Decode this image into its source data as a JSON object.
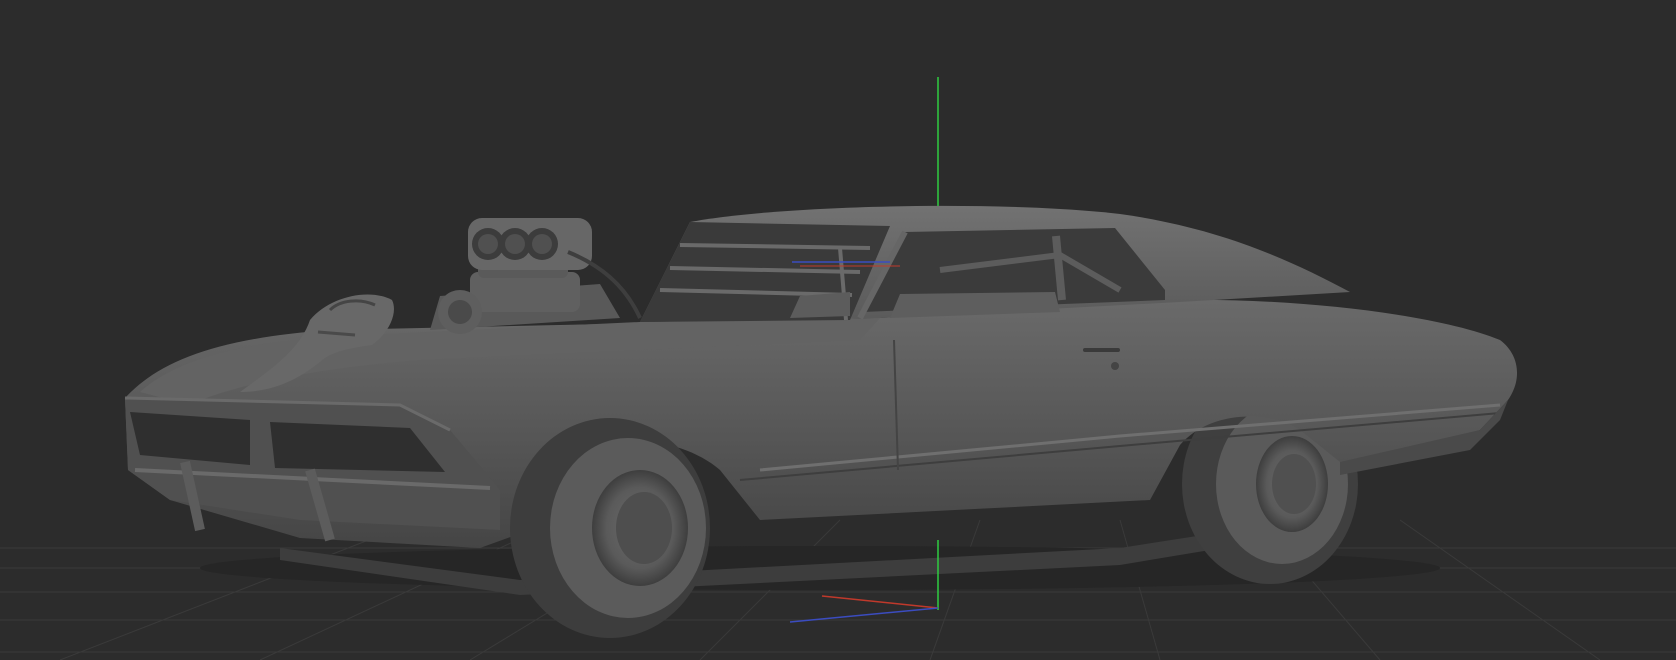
{
  "viewport": {
    "background": "#2c2c2c",
    "grid_visible": true,
    "gizmo_visible": true
  },
  "model": {
    "subject": "muscle-car",
    "material": "clay-gray",
    "base_color": "#555555",
    "shadow_color": "#3a3a3a",
    "highlight_color": "#6e6e6e"
  },
  "axes": {
    "x_color": "#c0392b",
    "y_color": "#2ecc40",
    "z_color": "#3b4cc0"
  }
}
